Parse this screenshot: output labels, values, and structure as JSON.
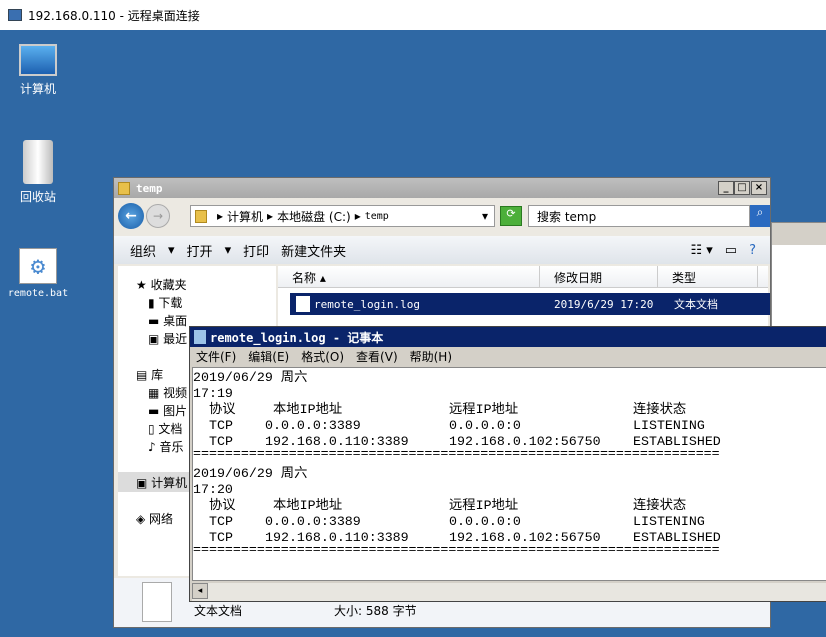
{
  "rdp_title": "192.168.0.110 - 远程桌面连接",
  "desktop": [
    {
      "label": "计算机"
    },
    {
      "label": "回收站"
    },
    {
      "label": "remote.bat"
    }
  ],
  "explorer": {
    "title": "temp",
    "breadcrumb": [
      "计算机",
      "本地磁盘 (C:)",
      "temp"
    ],
    "search_placeholder": "搜索 temp",
    "toolbar": [
      "组织",
      "打开",
      "打印",
      "新建文件夹"
    ],
    "sidebar": [
      "收藏夹",
      "下载",
      "桌面",
      "最近",
      "库",
      "视频",
      "图片",
      "文档",
      "音乐",
      "计算机",
      "网络"
    ],
    "columns": [
      "名称",
      "修改日期",
      "类型"
    ],
    "file": {
      "name": "remote_login.log",
      "date": "2019/6/29 17:20",
      "type": "文本文档"
    },
    "details": {
      "type": "文本文档",
      "size": "大小: 588 字节"
    }
  },
  "notepad": {
    "title": "remote_login.log - 记事本",
    "menu": [
      "文件(F)",
      "编辑(E)",
      "格式(O)",
      "查看(V)",
      "帮助(H)"
    ],
    "blocks": [
      {
        "date": "2019/06/29 周六",
        "time": "17:19",
        "headers": [
          "协议",
          "本地IP地址",
          "远程IP地址",
          "连接状态"
        ],
        "rows": [
          [
            "TCP",
            "0.0.0.0:3389",
            "0.0.0.0:0",
            "LISTENING"
          ],
          [
            "TCP",
            "192.168.0.110:3389",
            "192.168.0.102:56750",
            "ESTABLISHED"
          ]
        ]
      },
      {
        "date": "2019/06/29 周六",
        "time": "17:20",
        "headers": [
          "协议",
          "本地IP地址",
          "远程IP地址",
          "连接状态"
        ],
        "rows": [
          [
            "TCP",
            "0.0.0.0:3389",
            "0.0.0.0:0",
            "LISTENING"
          ],
          [
            "TCP",
            "192.168.0.110:3389",
            "192.168.0.102:56750",
            "ESTABLISHED"
          ]
        ]
      }
    ],
    "separator": "=================================================================="
  }
}
